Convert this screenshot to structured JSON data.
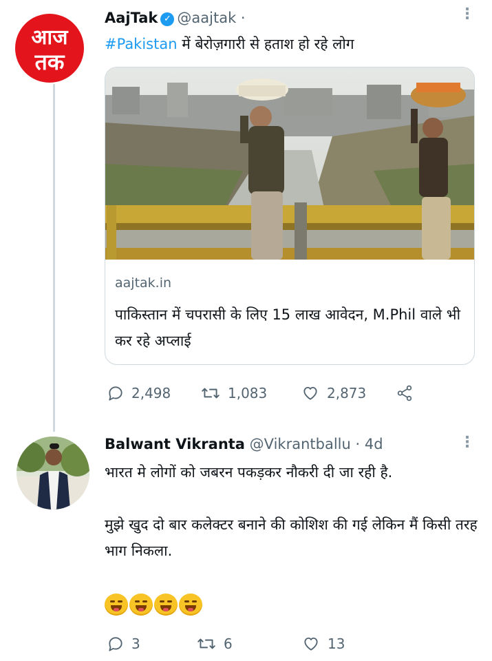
{
  "tweet1": {
    "avatar_logo": [
      "आज",
      "तक"
    ],
    "name": "AajTak",
    "handle": "@aajtak",
    "separator": "·",
    "hashtag": "#Pakistan",
    "text": " में बेरोज़गारी से हताश हो रहे लोग",
    "card": {
      "domain": "aajtak.in",
      "title": "पाकिस्तान में चपरासी के लिए 15 लाख आवेदन, M.Phil वाले भी कर रहे अप्लाई"
    },
    "actions": {
      "replies": "2,498",
      "retweets": "1,083",
      "likes": "2,873"
    }
  },
  "tweet2": {
    "name": "Balwant Vikranta",
    "handle": "@Vikrantballu",
    "time": "· 4d",
    "text_para1": "भारत मे लोगों को जबरन पकड़कर नौकरी दी जा रही है.",
    "text_para2": "मुझे खुद दो बार कलेक्टर बनाने की कोशिश की गई लेकिन मैं किसी तरह भाग निकला.",
    "emoji_count": 4,
    "actions": {
      "replies": "3",
      "retweets": "6",
      "likes": "13"
    }
  },
  "colors": {
    "accent": "#1d9bf0",
    "logo_red": "#e3141b",
    "muted": "#536471"
  }
}
